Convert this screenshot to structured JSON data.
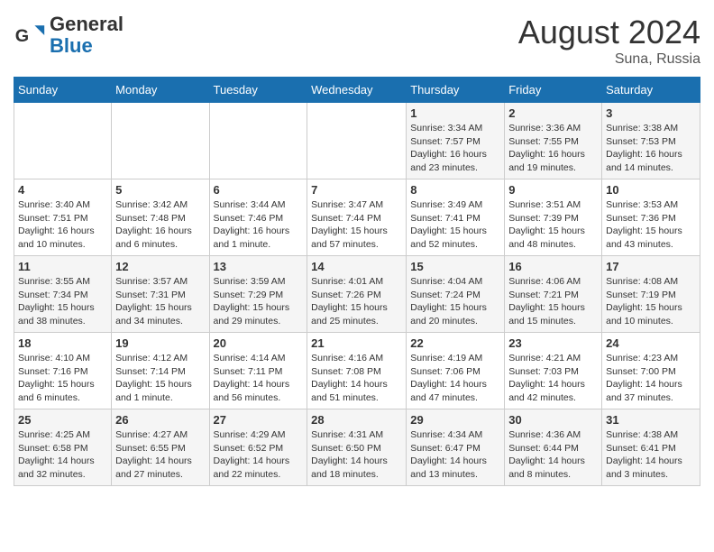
{
  "header": {
    "logo_general": "General",
    "logo_blue": "Blue",
    "month_year": "August 2024",
    "location": "Suna, Russia"
  },
  "weekdays": [
    "Sunday",
    "Monday",
    "Tuesday",
    "Wednesday",
    "Thursday",
    "Friday",
    "Saturday"
  ],
  "weeks": [
    [
      {
        "day": "",
        "info": ""
      },
      {
        "day": "",
        "info": ""
      },
      {
        "day": "",
        "info": ""
      },
      {
        "day": "",
        "info": ""
      },
      {
        "day": "1",
        "info": "Sunrise: 3:34 AM\nSunset: 7:57 PM\nDaylight: 16 hours and 23 minutes."
      },
      {
        "day": "2",
        "info": "Sunrise: 3:36 AM\nSunset: 7:55 PM\nDaylight: 16 hours and 19 minutes."
      },
      {
        "day": "3",
        "info": "Sunrise: 3:38 AM\nSunset: 7:53 PM\nDaylight: 16 hours and 14 minutes."
      }
    ],
    [
      {
        "day": "4",
        "info": "Sunrise: 3:40 AM\nSunset: 7:51 PM\nDaylight: 16 hours and 10 minutes."
      },
      {
        "day": "5",
        "info": "Sunrise: 3:42 AM\nSunset: 7:48 PM\nDaylight: 16 hours and 6 minutes."
      },
      {
        "day": "6",
        "info": "Sunrise: 3:44 AM\nSunset: 7:46 PM\nDaylight: 16 hours and 1 minute."
      },
      {
        "day": "7",
        "info": "Sunrise: 3:47 AM\nSunset: 7:44 PM\nDaylight: 15 hours and 57 minutes."
      },
      {
        "day": "8",
        "info": "Sunrise: 3:49 AM\nSunset: 7:41 PM\nDaylight: 15 hours and 52 minutes."
      },
      {
        "day": "9",
        "info": "Sunrise: 3:51 AM\nSunset: 7:39 PM\nDaylight: 15 hours and 48 minutes."
      },
      {
        "day": "10",
        "info": "Sunrise: 3:53 AM\nSunset: 7:36 PM\nDaylight: 15 hours and 43 minutes."
      }
    ],
    [
      {
        "day": "11",
        "info": "Sunrise: 3:55 AM\nSunset: 7:34 PM\nDaylight: 15 hours and 38 minutes."
      },
      {
        "day": "12",
        "info": "Sunrise: 3:57 AM\nSunset: 7:31 PM\nDaylight: 15 hours and 34 minutes."
      },
      {
        "day": "13",
        "info": "Sunrise: 3:59 AM\nSunset: 7:29 PM\nDaylight: 15 hours and 29 minutes."
      },
      {
        "day": "14",
        "info": "Sunrise: 4:01 AM\nSunset: 7:26 PM\nDaylight: 15 hours and 25 minutes."
      },
      {
        "day": "15",
        "info": "Sunrise: 4:04 AM\nSunset: 7:24 PM\nDaylight: 15 hours and 20 minutes."
      },
      {
        "day": "16",
        "info": "Sunrise: 4:06 AM\nSunset: 7:21 PM\nDaylight: 15 hours and 15 minutes."
      },
      {
        "day": "17",
        "info": "Sunrise: 4:08 AM\nSunset: 7:19 PM\nDaylight: 15 hours and 10 minutes."
      }
    ],
    [
      {
        "day": "18",
        "info": "Sunrise: 4:10 AM\nSunset: 7:16 PM\nDaylight: 15 hours and 6 minutes."
      },
      {
        "day": "19",
        "info": "Sunrise: 4:12 AM\nSunset: 7:14 PM\nDaylight: 15 hours and 1 minute."
      },
      {
        "day": "20",
        "info": "Sunrise: 4:14 AM\nSunset: 7:11 PM\nDaylight: 14 hours and 56 minutes."
      },
      {
        "day": "21",
        "info": "Sunrise: 4:16 AM\nSunset: 7:08 PM\nDaylight: 14 hours and 51 minutes."
      },
      {
        "day": "22",
        "info": "Sunrise: 4:19 AM\nSunset: 7:06 PM\nDaylight: 14 hours and 47 minutes."
      },
      {
        "day": "23",
        "info": "Sunrise: 4:21 AM\nSunset: 7:03 PM\nDaylight: 14 hours and 42 minutes."
      },
      {
        "day": "24",
        "info": "Sunrise: 4:23 AM\nSunset: 7:00 PM\nDaylight: 14 hours and 37 minutes."
      }
    ],
    [
      {
        "day": "25",
        "info": "Sunrise: 4:25 AM\nSunset: 6:58 PM\nDaylight: 14 hours and 32 minutes."
      },
      {
        "day": "26",
        "info": "Sunrise: 4:27 AM\nSunset: 6:55 PM\nDaylight: 14 hours and 27 minutes."
      },
      {
        "day": "27",
        "info": "Sunrise: 4:29 AM\nSunset: 6:52 PM\nDaylight: 14 hours and 22 minutes."
      },
      {
        "day": "28",
        "info": "Sunrise: 4:31 AM\nSunset: 6:50 PM\nDaylight: 14 hours and 18 minutes."
      },
      {
        "day": "29",
        "info": "Sunrise: 4:34 AM\nSunset: 6:47 PM\nDaylight: 14 hours and 13 minutes."
      },
      {
        "day": "30",
        "info": "Sunrise: 4:36 AM\nSunset: 6:44 PM\nDaylight: 14 hours and 8 minutes."
      },
      {
        "day": "31",
        "info": "Sunrise: 4:38 AM\nSunset: 6:41 PM\nDaylight: 14 hours and 3 minutes."
      }
    ]
  ]
}
